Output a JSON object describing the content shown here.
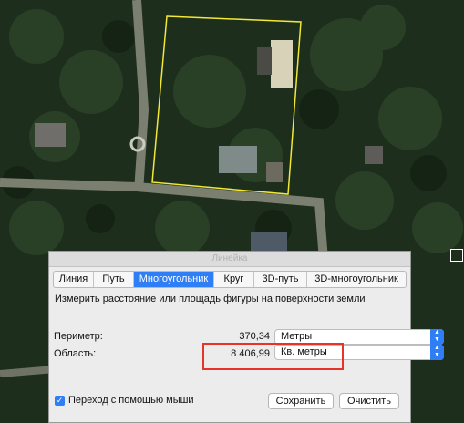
{
  "window": {
    "title": "Линейка"
  },
  "tabs": [
    {
      "label": "Линия",
      "active": false
    },
    {
      "label": "Путь",
      "active": false
    },
    {
      "label": "Многоугольник",
      "active": true
    },
    {
      "label": "Круг",
      "active": false
    },
    {
      "label": "3D-путь",
      "active": false
    },
    {
      "label": "3D-многоугольник",
      "active": false
    }
  ],
  "description": "Измерить расстояние или площадь фигуры на поверхности земли",
  "perimeter": {
    "label": "Периметр:",
    "value": "370,34",
    "unit": "Метры"
  },
  "area": {
    "label": "Область:",
    "value": "8 406,99",
    "unit": "Кв. метры"
  },
  "mouse_navigation": {
    "label": "Переход с помощью мыши",
    "checked": true
  },
  "buttons": {
    "save": "Сохранить",
    "clear": "Очистить"
  },
  "colors": {
    "accent": "#2f7ef6",
    "polygon": "#f2e836",
    "highlight": "#e5342a"
  }
}
